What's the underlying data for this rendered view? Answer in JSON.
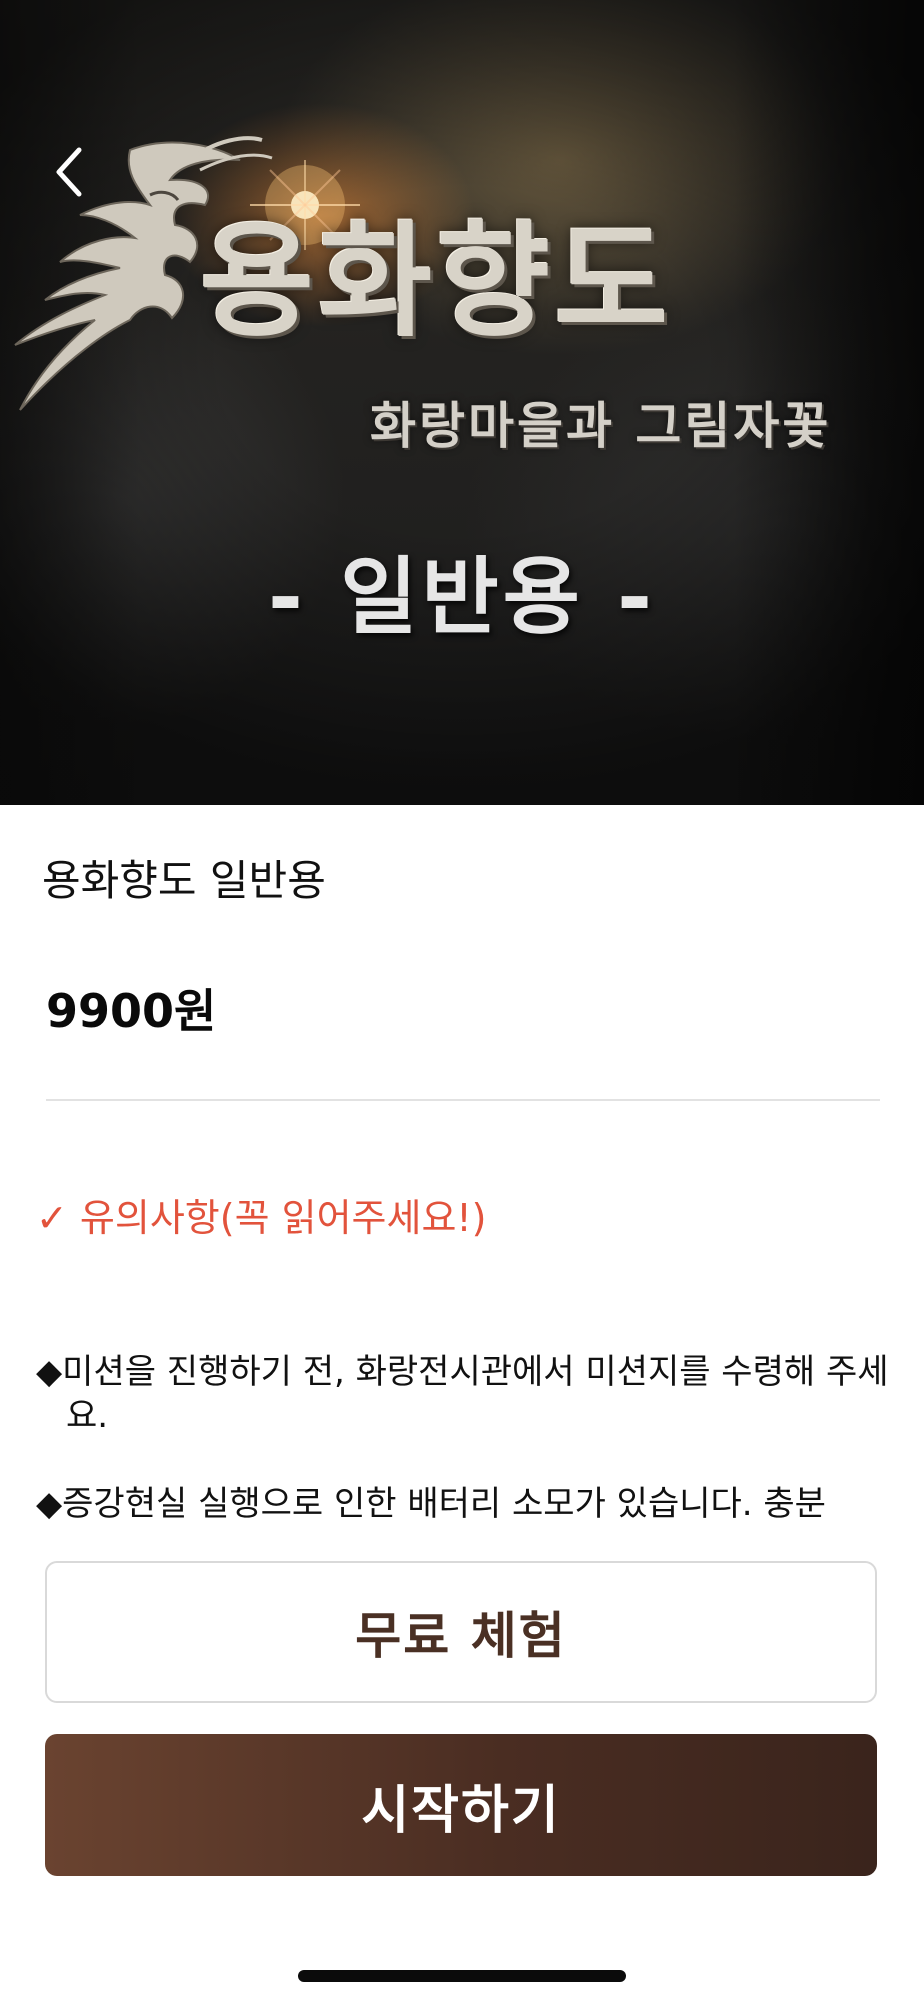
{
  "hero": {
    "title": "용화향도",
    "subtitle": "화랑마을과 그림자꽃",
    "badge": "- 일반용 -"
  },
  "product": {
    "name": "용화향도 일반용",
    "price": "9900원"
  },
  "notice": {
    "heading": "✓ 유의사항(꼭 읽어주세요!)",
    "heading_color": "#e2533c",
    "items": [
      "◆미션을 진행하기 전, 화랑전시관에서 미션지를 수령해 주세요.",
      "◆증강현실 실행으로 인한 배터리 소모가 있습니다. 충분"
    ]
  },
  "actions": {
    "trial_label": "무료 체험",
    "start_label": "시작하기",
    "start_color": "#4a2d22"
  },
  "icons": {
    "back": "chevron-left-icon",
    "logo": "dragon-emblem-icon"
  }
}
